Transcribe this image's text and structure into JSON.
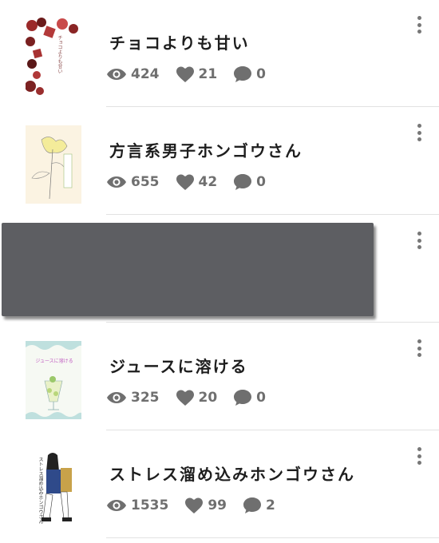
{
  "items": [
    {
      "title": "チョコよりも甘い",
      "cover_text": "チョコよりも甘い",
      "views": "424",
      "likes": "21",
      "comments": "0"
    },
    {
      "title": "方言系男子ホンゴウさん",
      "cover_text": "方言系男子ホンゴウさん",
      "views": "655",
      "likes": "42",
      "comments": "0"
    },
    {
      "title": "ジュースに溶ける",
      "cover_text": "ジュースに溶ける",
      "views": "325",
      "likes": "20",
      "comments": "0"
    },
    {
      "title": "ストレス溜め込みホンゴウさん",
      "cover_text": "ストレス溜め込みホンゴウさん",
      "views": "1535",
      "likes": "99",
      "comments": "2"
    }
  ],
  "icons": {
    "views": "eye-icon",
    "likes": "heart-icon",
    "comments": "comment-icon",
    "menu": "more-vert-icon"
  },
  "colors": {
    "icon": "#6f6f6f",
    "redaction": "#5d5e62"
  }
}
